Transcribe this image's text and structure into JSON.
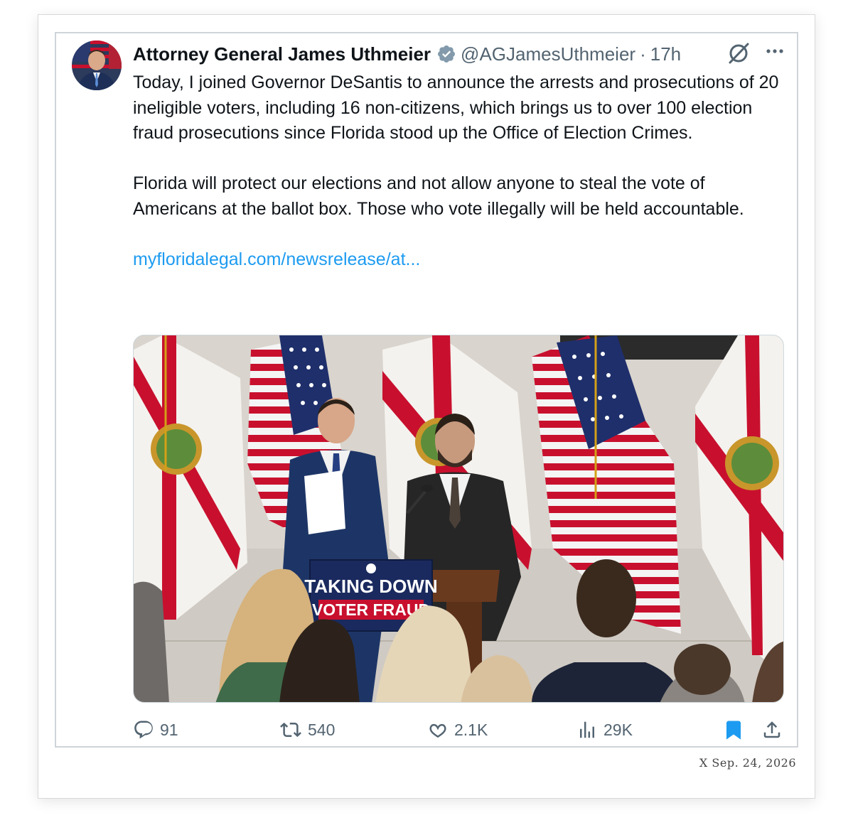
{
  "tweet": {
    "display_name": "Attorney General James Uthmeier",
    "handle": "@AGJamesUthmeier",
    "separator": "·",
    "time": "17h",
    "paragraph_1": "Today, I joined Governor DeSantis to announce the arrests and prosecutions of 20 ineligible voters, including 16 non-citizens, which brings us to over 100 election fraud prosecutions since Florida stood up the Office of Election Crimes.",
    "paragraph_2": "Florida will protect our elections and not allow anyone to steal the vote of Americans at the ballot box. Those who vote illegally will be held accountable.",
    "link": "myfloridalegal.com/newsrelease/at...",
    "media": {
      "podium_line_1": "TAKING DOWN",
      "podium_line_2": "VOTER FRAUD"
    },
    "stats": {
      "replies": "91",
      "reposts": "540",
      "likes": "2.1K",
      "views": "29K"
    }
  },
  "icons": {
    "verified": "verified-badge-icon",
    "grok": "grok-icon",
    "more": "more-icon",
    "reply": "reply-icon",
    "repost": "repost-icon",
    "like": "heart-icon",
    "views": "views-icon",
    "bookmark": "bookmark-icon",
    "share": "share-icon"
  },
  "colors": {
    "link": "#1d9bf0",
    "secondary_text": "#536471",
    "bookmark_active": "#1d9bf0"
  },
  "stamp": {
    "source": "X",
    "date": "Sep. 24, 2026"
  }
}
